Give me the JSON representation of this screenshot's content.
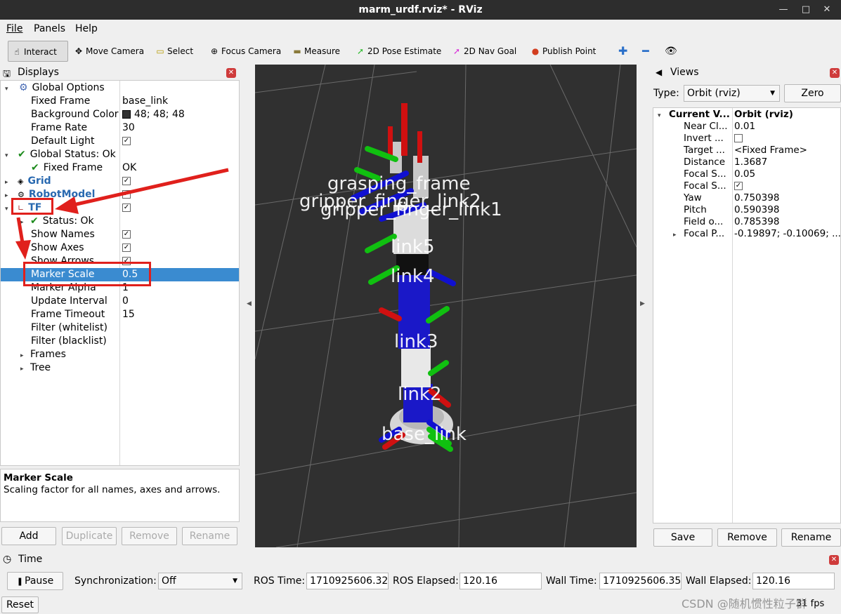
{
  "window": {
    "title": "marm_urdf.rviz* - RViz"
  },
  "menu": [
    "File",
    "Panels",
    "Help"
  ],
  "toolbar": {
    "interact": "Interact",
    "move_camera": "Move Camera",
    "select": "Select",
    "focus_camera": "Focus Camera",
    "measure": "Measure",
    "pose_estimate": "2D Pose Estimate",
    "nav_goal": "2D Nav Goal",
    "publish_point": "Publish Point"
  },
  "displays": {
    "title": "Displays",
    "rows": [
      {
        "label": "Global Options",
        "value": ""
      },
      {
        "label": "Fixed Frame",
        "value": "base_link"
      },
      {
        "label": "Background Color",
        "value": "48; 48; 48"
      },
      {
        "label": "Frame Rate",
        "value": "30"
      },
      {
        "label": "Default Light",
        "value": ""
      },
      {
        "label": "Global Status: Ok",
        "value": ""
      },
      {
        "label": "Fixed Frame",
        "value": "OK"
      },
      {
        "label": "Grid",
        "value": ""
      },
      {
        "label": "RobotModel",
        "value": ""
      },
      {
        "label": "TF",
        "value": ""
      },
      {
        "label": "Status: Ok",
        "value": ""
      },
      {
        "label": "Show Names",
        "value": ""
      },
      {
        "label": "Show Axes",
        "value": ""
      },
      {
        "label": "Show Arrows",
        "value": ""
      },
      {
        "label": "Marker Scale",
        "value": "0.5"
      },
      {
        "label": "Marker Alpha",
        "value": "1"
      },
      {
        "label": "Update Interval",
        "value": "0"
      },
      {
        "label": "Frame Timeout",
        "value": "15"
      },
      {
        "label": "Filter (whitelist)",
        "value": ""
      },
      {
        "label": "Filter (blacklist)",
        "value": ""
      },
      {
        "label": "Frames",
        "value": ""
      },
      {
        "label": "Tree",
        "value": ""
      }
    ],
    "desc_title": "Marker Scale",
    "desc_text": "Scaling factor for all names, axes and arrows.",
    "buttons": {
      "add": "Add",
      "duplicate": "Duplicate",
      "remove": "Remove",
      "rename": "Rename"
    }
  },
  "viewport_labels": [
    "grasping_frame",
    "gripper_finger_link2",
    "gripper_finger_link1",
    "link5",
    "link4",
    "link3",
    "link2",
    "base_link"
  ],
  "views": {
    "title": "Views",
    "type_label": "Type:",
    "type_value": "Orbit (rviz)",
    "zero": "Zero",
    "rows": [
      {
        "label": "Current V...",
        "value": "Orbit (rviz)"
      },
      {
        "label": "Near Cl...",
        "value": "0.01"
      },
      {
        "label": "Invert ...",
        "value": ""
      },
      {
        "label": "Target ...",
        "value": "<Fixed Frame>"
      },
      {
        "label": "Distance",
        "value": "1.3687"
      },
      {
        "label": "Focal S...",
        "value": "0.05"
      },
      {
        "label": "Focal S...",
        "value": ""
      },
      {
        "label": "Yaw",
        "value": "0.750398"
      },
      {
        "label": "Pitch",
        "value": "0.590398"
      },
      {
        "label": "Field o...",
        "value": "0.785398"
      },
      {
        "label": "Focal P...",
        "value": "-0.19897; -0.10069; ..."
      }
    ],
    "buttons": {
      "save": "Save",
      "remove": "Remove",
      "rename": "Rename"
    }
  },
  "time": {
    "title": "Time",
    "pause": "Pause",
    "sync_label": "Synchronization:",
    "sync_value": "Off",
    "ros_time_label": "ROS Time:",
    "ros_time": "1710925606.32",
    "ros_elapsed_label": "ROS Elapsed:",
    "ros_elapsed": "120.16",
    "wall_time_label": "Wall Time:",
    "wall_time": "1710925606.35",
    "wall_elapsed_label": "Wall Elapsed:",
    "wall_elapsed": "120.16"
  },
  "status": {
    "reset": "Reset",
    "fps": "31 fps",
    "watermark": "CSDN @随机惯性粒子群"
  },
  "colors": {
    "highlight": "#3a8bd0",
    "annotation": "#e0201c",
    "viewport_bg": "#303030"
  }
}
